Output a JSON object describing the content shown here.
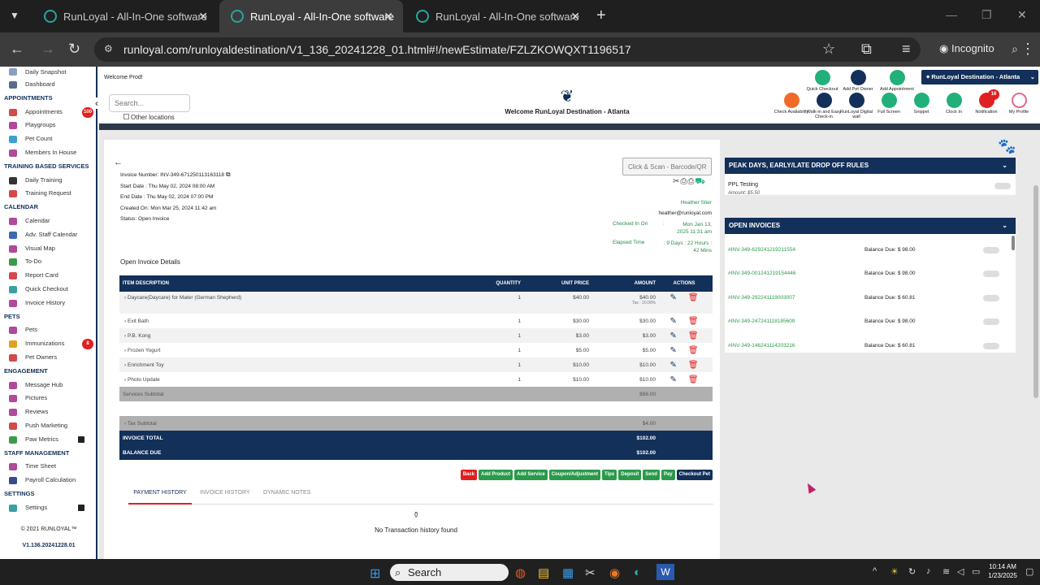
{
  "browser": {
    "tabs": [
      {
        "title": "RunLoyal - All-In-One software"
      },
      {
        "title": "RunLoyal - All-In-One software"
      },
      {
        "title": "RunLoyal - All-In-One software"
      }
    ],
    "url": "runloyal.com/runloyaldestination/V1_136_20241228_01.html#!/newEstimate/FZLZKOWQXT1196517",
    "profile": "Incognito"
  },
  "sidebar": {
    "top": [
      "Daily Snapshot",
      "Dashboard"
    ],
    "appointments_label": "APPOINTMENTS",
    "appointments": [
      "Appointments",
      "Playgroups",
      "Pet Count",
      "Members In House"
    ],
    "appointments_badge": "100",
    "training_label": "TRAINING BASED SERVICES",
    "training": [
      "Daily Training",
      "Training Request"
    ],
    "calendar_label": "CALENDAR",
    "calendar": [
      "Calendar",
      "Adv. Staff Calendar",
      "Visual Map",
      "To-Do",
      "Report Card",
      "Quick Checkout",
      "Invoice History"
    ],
    "pets_label": "PETS",
    "pets": [
      "Pets",
      "Immunizations",
      "Pet Owners"
    ],
    "immunizations_badge": "8",
    "engagement_label": "ENGAGEMENT",
    "engagement": [
      "Message Hub",
      "Pictures",
      "Reviews",
      "Push Marketing",
      "Paw Metrics"
    ],
    "staff_label": "STAFF MANAGEMENT",
    "staff": [
      "Time Sheet",
      "Payroll Calculation"
    ],
    "settings_label": "SETTINGS",
    "settings": [
      "Settings"
    ],
    "copyright": "© 2021  RUNLOYAL™",
    "version": "V1.136.20241228.01"
  },
  "header": {
    "welcome_user": "Welcome Prod!",
    "search_placeholder": "Search...",
    "other_locations": "Other locations",
    "brand_welcome": "Welcome RunLoyal Destination - Atlanta",
    "location": "RunLoyal Destination - Atlanta",
    "top_actions": [
      "Quick Checkout",
      "Add Pet Owner",
      "Add Appointment"
    ],
    "icons": [
      {
        "label": "Check Availability",
        "color": "#f06a2a"
      },
      {
        "label": "Walk-in and Easy Check-in",
        "color": "#12305a"
      },
      {
        "label": "RunLoyal Digital wall",
        "color": "#12305a"
      },
      {
        "label": "Full Screen",
        "color": "#22b07a"
      },
      {
        "label": "Snippet",
        "color": "#22b07a"
      },
      {
        "label": "Clock In",
        "color": "#22b07a"
      },
      {
        "label": "Notification",
        "color": "#e02020"
      },
      {
        "label": "My Profile",
        "color": "#e06a8a"
      }
    ],
    "notification_badge": "16"
  },
  "invoice": {
    "number": "Invoice Number: INV-349-671250113163118",
    "start": "Start Date : Thu May 02, 2024 08:00 AM",
    "end": "End Date : Thu May 02, 2024 07:00 PM",
    "created": "Created On: Mon Mar 25, 2024 11:42 am",
    "status": "Status: Open Invoice",
    "scan_placeholder": "Click & Scan - Barcode/QR",
    "staff_name": "Heather Stier",
    "staff_email": "heather@runloyal.com",
    "checked_in_label": "Checked In On",
    "checked_in_value": "Mon Jan 13, 2025 11:31 am",
    "elapsed_label": "Elapsed Time",
    "elapsed_value": ": 9 Days : 22 Hours : 42 Mins",
    "details_title": "Open Invoice Details",
    "columns": [
      "ITEM DESCRIPTION",
      "QUANTITY",
      "UNIT PRICE",
      "AMOUNT",
      "ACTIONS"
    ],
    "items": [
      {
        "desc": "Daycare(Daycare) for Mater (German Shepherd)",
        "qty": "1",
        "unit": "$40.00",
        "amount": "$40.00",
        "tax": "Tax : 10.00%"
      },
      {
        "desc": "Exit Bath",
        "qty": "1",
        "unit": "$30.00",
        "amount": "$30.00"
      },
      {
        "desc": "P.B. Kong",
        "qty": "1",
        "unit": "$3.00",
        "amount": "$3.00"
      },
      {
        "desc": "Frozen Yogurt",
        "qty": "1",
        "unit": "$5.00",
        "amount": "$5.00"
      },
      {
        "desc": "Enrichment Toy",
        "qty": "1",
        "unit": "$10.00",
        "amount": "$10.00"
      },
      {
        "desc": "Photo Update",
        "qty": "1",
        "unit": "$10.00",
        "amount": "$10.00"
      }
    ],
    "services_subtotal_label": "Services Subtotal",
    "services_subtotal": "$98.00",
    "tax_subtotal_label": "Tax Subtotal",
    "tax_subtotal": "$4.00",
    "total_label": "INVOICE TOTAL",
    "total": "$102.00",
    "balance_label": "BALANCE DUE",
    "balance": "$102.00",
    "buttons": [
      {
        "label": "Back",
        "color": "#e02020"
      },
      {
        "label": "Add Product",
        "color": "#2a9a4a"
      },
      {
        "label": "Add Service",
        "color": "#2a9a4a"
      },
      {
        "label": "Coupon/Adjustment",
        "color": "#2a9a4a"
      },
      {
        "label": "Tips",
        "color": "#2a9a4a"
      },
      {
        "label": "Deposit",
        "color": "#2a9a4a"
      },
      {
        "label": "Send",
        "color": "#2a9a4a"
      },
      {
        "label": "Pay",
        "color": "#2a9a4a"
      },
      {
        "label": "Checkout Pet",
        "color": "#12305a"
      }
    ],
    "history_tabs": [
      "PAYMENT HISTORY",
      "INVOICE HISTORY",
      "DYNAMIC NOTES"
    ],
    "no_history": "No Transaction history found"
  },
  "right": {
    "peak_title": "PEAK DAYS, EARLY/LATE DROP OFF RULES",
    "ppl_name": "PPL Testing",
    "ppl_amount": "Amount: $5.50",
    "open_title": "OPEN INVOICES",
    "open_invoices": [
      {
        "id": "#INV-349-629241219211554",
        "due": "Balance Due: $ 98.00"
      },
      {
        "id": "#INV-349-001241219154446",
        "due": "Balance Due: $ 98.00"
      },
      {
        "id": "#INV-349-292241119003007",
        "due": "Balance Due: $ 60.81"
      },
      {
        "id": "#INV-349-247241118185609",
        "due": "Balance Due: $ 98.00"
      },
      {
        "id": "#INV-349-146241114203216",
        "due": "Balance Due: $ 60.81"
      }
    ]
  },
  "taskbar": {
    "search": "Search",
    "time": "10:14 AM",
    "date": "1/23/2025"
  }
}
